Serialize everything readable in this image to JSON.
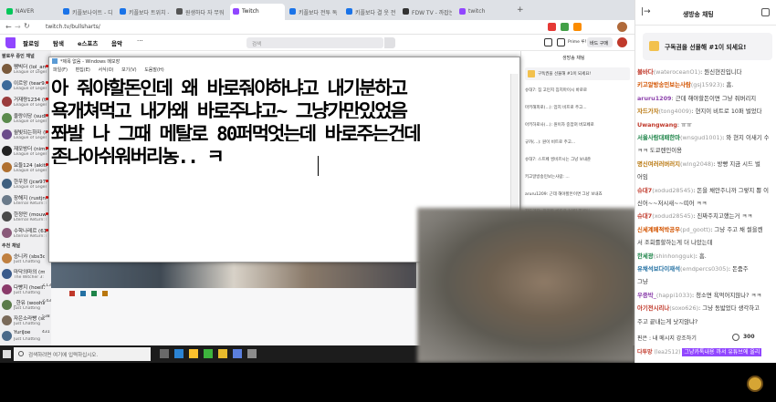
{
  "browser": {
    "tabs": [
      {
        "label": "NAVER",
        "color": "#03c75a"
      },
      {
        "label": "키플보나이트 - 디플끌키나...",
        "color": "#1a73e8"
      },
      {
        "label": "키플보다 트위치 - 바드...",
        "color": "#1a73e8"
      },
      {
        "label": "원생하다 자 무워 자...",
        "color": "#555555"
      },
      {
        "label": "Twitch",
        "color": "#9146ff"
      },
      {
        "label": "키플보다 전투 독 무워 FDW",
        "color": "#1a73e8"
      },
      {
        "label": "키플보다 결 웃 전투체계...",
        "color": "#1a73e8"
      },
      {
        "label": "FDW TV - 까잡는 화락 (레임...",
        "color": "#333333"
      },
      {
        "label": "twitch",
        "color": "#9146ff"
      }
    ],
    "url": "twitch.tv/bullsharts/",
    "search_placeholder": "검색"
  },
  "twitch_nav": {
    "items": [
      "팔로잉",
      "탐색",
      "e스포츠",
      "음악"
    ],
    "right_labels": [
      "Prime 루트",
      "바드 구매"
    ]
  },
  "sidebar": {
    "followed_header": "팔로우 중인 채널",
    "followed": [
      {
        "name": "펭빅더 (lol_ambi...",
        "game": "League of Legends",
        "color": "#7a5a3c"
      },
      {
        "name": "이르앙 (tear9...",
        "game": "League of Legends",
        "color": "#3c6a9a"
      },
      {
        "name": "거재량1234 (tg...",
        "game": "League of Legends",
        "color": "#9a3c3c"
      },
      {
        "name": "울랑이당 (sudlhe...",
        "game": "League of Legends",
        "color": "#5a8a4c"
      },
      {
        "name": "월빛되는하자 (ko...",
        "game": "League of Legends",
        "color": "#6a4c8a"
      },
      {
        "name": "재모방더 (nimkai...",
        "game": "League of Legends",
        "color": "#222222"
      },
      {
        "name": "요들124 (akitking...",
        "game": "League of Legends",
        "color": "#b07030"
      },
      {
        "name": "한우정 (jcw970...",
        "game": "League of Legends",
        "color": "#406080"
      },
      {
        "name": "장해지 (rustjn1...",
        "game": "Eternal Return: Bl...",
        "color": "#6a7a8a"
      },
      {
        "name": "한정만 (mouw82...",
        "game": "Eternal Return: Bl...",
        "color": "#4a4a4a"
      },
      {
        "name": "수학나레르 (618...",
        "game": "Eternal Return: Bl...",
        "color": "#8a5a7a"
      }
    ],
    "recommended_header": "추천 채널",
    "recommended": [
      {
        "name": "승니캬 (sbs3o)",
        "game": "Just Chatting",
        "color": "#c08040"
      },
      {
        "name": "마닥의마의 (mad...",
        "game": "The Witcher 3: Wil...",
        "color": "#3a5a8a"
      },
      {
        "name": "다빵지 (hoeil123)",
        "game": "Just Chatting",
        "color": "#8a3a6a",
        "count": "2,134"
      },
      {
        "name": "_한유 (woohanky...",
        "game": "Just Chatting",
        "color": "#5a7a4a",
        "count": "2,434"
      },
      {
        "name": "자은소라빵 (sorab...",
        "game": "Just Chatting",
        "color": "#7a6a5a",
        "count": "538"
      },
      {
        "name": "YuriJoe",
        "game": "Just Chatting",
        "color": "#4a6a8a",
        "count": "431"
      }
    ]
  },
  "taskbar": {
    "search_placeholder": "검색하려면 여기에 입력하십시오."
  },
  "notepad": {
    "title": "*제목 없음 - Windows 메모장",
    "menu": [
      "파일(F)",
      "편집(E)",
      "서식(O)",
      "보기(V)",
      "도움말(H)"
    ],
    "lines": [
      "아 줘야할돈인데 왜 바로줘야하냐고 내기분하고",
      "욕개쳐먹고 내가왜 바로주냐고~ 그냥가만있었음",
      "쫘발 나 그때 메탈로 80퍼먹엇는데 바로주는건데",
      "존나아쉬워버리농.. ㅋ"
    ]
  },
  "minichat": {
    "title": "생방송 채팅",
    "pinned": "구독권을 선물해 #1이 되세요!",
    "messages": [
      "슈대7: 짐 고민지 짐지마이시 바로로",
      "마키해피로(...): 엄지 비프로 주고...",
      "아키하로사(...): 원이자 중잡혀 버꼬페로",
      "규카(...): 원이 비트로 주고...",
      "슈대7: 스프페 씽비르시는 그냥 보내준",
      "키고알방송민보는사람: ...",
      "aruru1209: 근데 해야할돈이면 그냥 보내죠",
      "자드가자: 짐지마 비트로 10퍼 몇메인",
      "Uwangwang: ㅠㅠ"
    ]
  },
  "chat": {
    "title": "생방송 채팅",
    "pinned": "구독권을 선물해 #1이 되세요!",
    "messages": [
      {
        "user": "볼바다",
        "id": "(wateroceanO1)",
        "color": "#c0392b",
        "text": ": 뭔신현진입니다"
      },
      {
        "user": "키고알방송민보는사람",
        "id": "(gsj15923)",
        "color": "#d35400",
        "text": ": 흠."
      },
      {
        "user": "aruru1209",
        "id": "",
        "color": "#8e44ad",
        "text": ": 근데 해야할돈이면 그냥 줘버리지"
      },
      {
        "user": "자드가자",
        "id": "(tong4009)",
        "color": "#b9770e",
        "text": ": 현지이 비트로 10퍼 벌었다"
      },
      {
        "user": "Uwangwang",
        "id": "",
        "color": "#c0392b",
        "text": ": ㅠㅠ"
      },
      {
        "user": "서울사람대패한마",
        "id": "(wnsgud1001)",
        "color": "#1e8449",
        "text": ": 와 현지 이새기 수"
      },
      {
        "user": "",
        "id": "",
        "color": "#333333",
        "text": "ㅋㅋ 도쿄렌인이용"
      },
      {
        "user": "명신여러러버러지",
        "id": "(wlng2048)",
        "color": "#b9770e",
        "text": ": 방빵 지금 시드 벌"
      },
      {
        "user": "",
        "id": "",
        "color": "#333333",
        "text": "어임"
      },
      {
        "user": "슈대7",
        "id": "(xodud28545)",
        "color": "#c0392b",
        "text": ": 돈을 채안주니까 그렇지 뿅 이"
      },
      {
        "user": "",
        "id": "",
        "color": "#333333",
        "text": "신어~~저시새~~띠어 ㅋㅋ"
      },
      {
        "user": "슈대7",
        "id": "(xodud28545)",
        "color": "#c0392b",
        "text": ": 진짜주치고했는거 ㅋㅋ"
      },
      {
        "user": "신세계페적박공우",
        "id": "(pd_goott)",
        "color": "#d35400",
        "text": ": 그냥 주고 채 씰을켄"
      },
      {
        "user": "",
        "id": "",
        "color": "#333333",
        "text": "서 조회를할하는게 더 나았는데"
      },
      {
        "user": "한세광",
        "id": "(shinhongguk)",
        "color": "#1e8449",
        "text": ": 흠."
      },
      {
        "user": "유채석보다이재석",
        "id": "(emdpercs0305)",
        "color": "#2471a3",
        "text": ": 돈줌주"
      },
      {
        "user": "",
        "id": "",
        "color": "#333333",
        "text": "그냥"
      },
      {
        "user": "우중박_",
        "id": "(happi1033)",
        "color": "#8e44ad",
        "text": ": 청소면 욕먹어지않나? ㅋㅋ"
      },
      {
        "user": "아기전시리나",
        "id": "(soxo626)",
        "color": "#c0392b",
        "text": ": 그냥 동밟었다 생각하고"
      },
      {
        "user": "",
        "id": "",
        "color": "#333333",
        "text": "주고 끝내는게 낫지않냐?"
      }
    ],
    "input_label": "핀은 : 내 메시지 강조하기",
    "points": "300",
    "last_user": "다투망",
    "last_id": "(lea2512)",
    "last_text": "그냥카톡내용 까서 유튜브에 올리"
  }
}
